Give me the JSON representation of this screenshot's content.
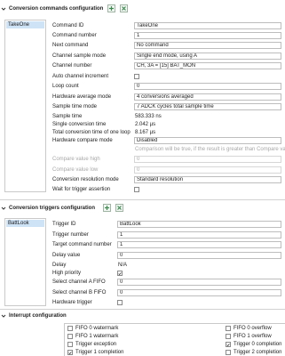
{
  "conversion_commands": {
    "title": "Conversion commands configuration",
    "list_items": [
      "TakeOne"
    ],
    "fields": {
      "command_id": {
        "label": "Command ID",
        "value": "TakeOne"
      },
      "command_number": {
        "label": "Command number",
        "value": "1"
      },
      "next_command": {
        "label": "Next command",
        "value": "No command"
      },
      "channel_sample_mode": {
        "label": "Channel sample mode",
        "value": "Single end mode, using A"
      },
      "channel_number": {
        "label": "Channel number",
        "value": "CH, 3A = [15] BAT_MON"
      },
      "auto_channel_increment": {
        "label": "Auto channel increment"
      },
      "loop_count": {
        "label": "Loop count",
        "value": "0"
      },
      "hardware_average_mode": {
        "label": "Hardware average mode",
        "value": "4 conversions averaged"
      },
      "sample_time_mode": {
        "label": "Sample time mode",
        "value": "7 ADCK cycles total sample time"
      },
      "sample_time": {
        "label": "Sample time",
        "value": "583.333 ns"
      },
      "single_conversion_time": {
        "label": "Single conversion time",
        "value": "2.042 µs"
      },
      "total_conversion_time": {
        "label": "Total conversion time of one loop",
        "value": "8.167 µs"
      },
      "hardware_compare_mode": {
        "label": "Hardware compare mode",
        "value": "Disabled"
      },
      "compare_note": "Comparison will be true, if the result is greater than Compare value high",
      "compare_value_high": {
        "label": "Compare value high",
        "value": "0"
      },
      "compare_value_low": {
        "label": "Compare value low",
        "value": "0"
      },
      "conversion_resolution_mode": {
        "label": "Conversion resolution mode",
        "value": "Standard resolution"
      },
      "wait_for_trigger": {
        "label": "Wait for trigger assertion"
      }
    }
  },
  "conversion_triggers": {
    "title": "Conversion triggers configuration",
    "list_items": [
      "BattLook"
    ],
    "fields": {
      "trigger_id": {
        "label": "Trigger ID",
        "value": "BattLook"
      },
      "trigger_number": {
        "label": "Trigger number",
        "value": "1"
      },
      "target_command_number": {
        "label": "Target command number",
        "value": "1"
      },
      "delay_value": {
        "label": "Delay value",
        "value": "0"
      },
      "delay": {
        "label": "Delay",
        "value": "N/A"
      },
      "high_priority": {
        "label": "High priority"
      },
      "select_channel_a_fifo": {
        "label": "Select channel A FIFO",
        "value": "0"
      },
      "select_channel_b_fifo": {
        "label": "Select channel B FIFO",
        "value": "0"
      },
      "hardware_trigger": {
        "label": "Hardware trigger"
      }
    }
  },
  "interrupt": {
    "title": "Interrupt configuration",
    "left_items": [
      "FIFO 0 watermark",
      "FIFO 1 watermark",
      "Trigger exception",
      "Trigger 1 completion"
    ],
    "right_items": [
      "FIFO 0 overflow",
      "FIFO 1 overflow",
      "Trigger 0 completion",
      "Trigger 2 completion"
    ]
  },
  "colors": {
    "accent_green": "#3c8a4f",
    "selection_blue": "#cfe3f7",
    "header_chevron": "#333333"
  }
}
